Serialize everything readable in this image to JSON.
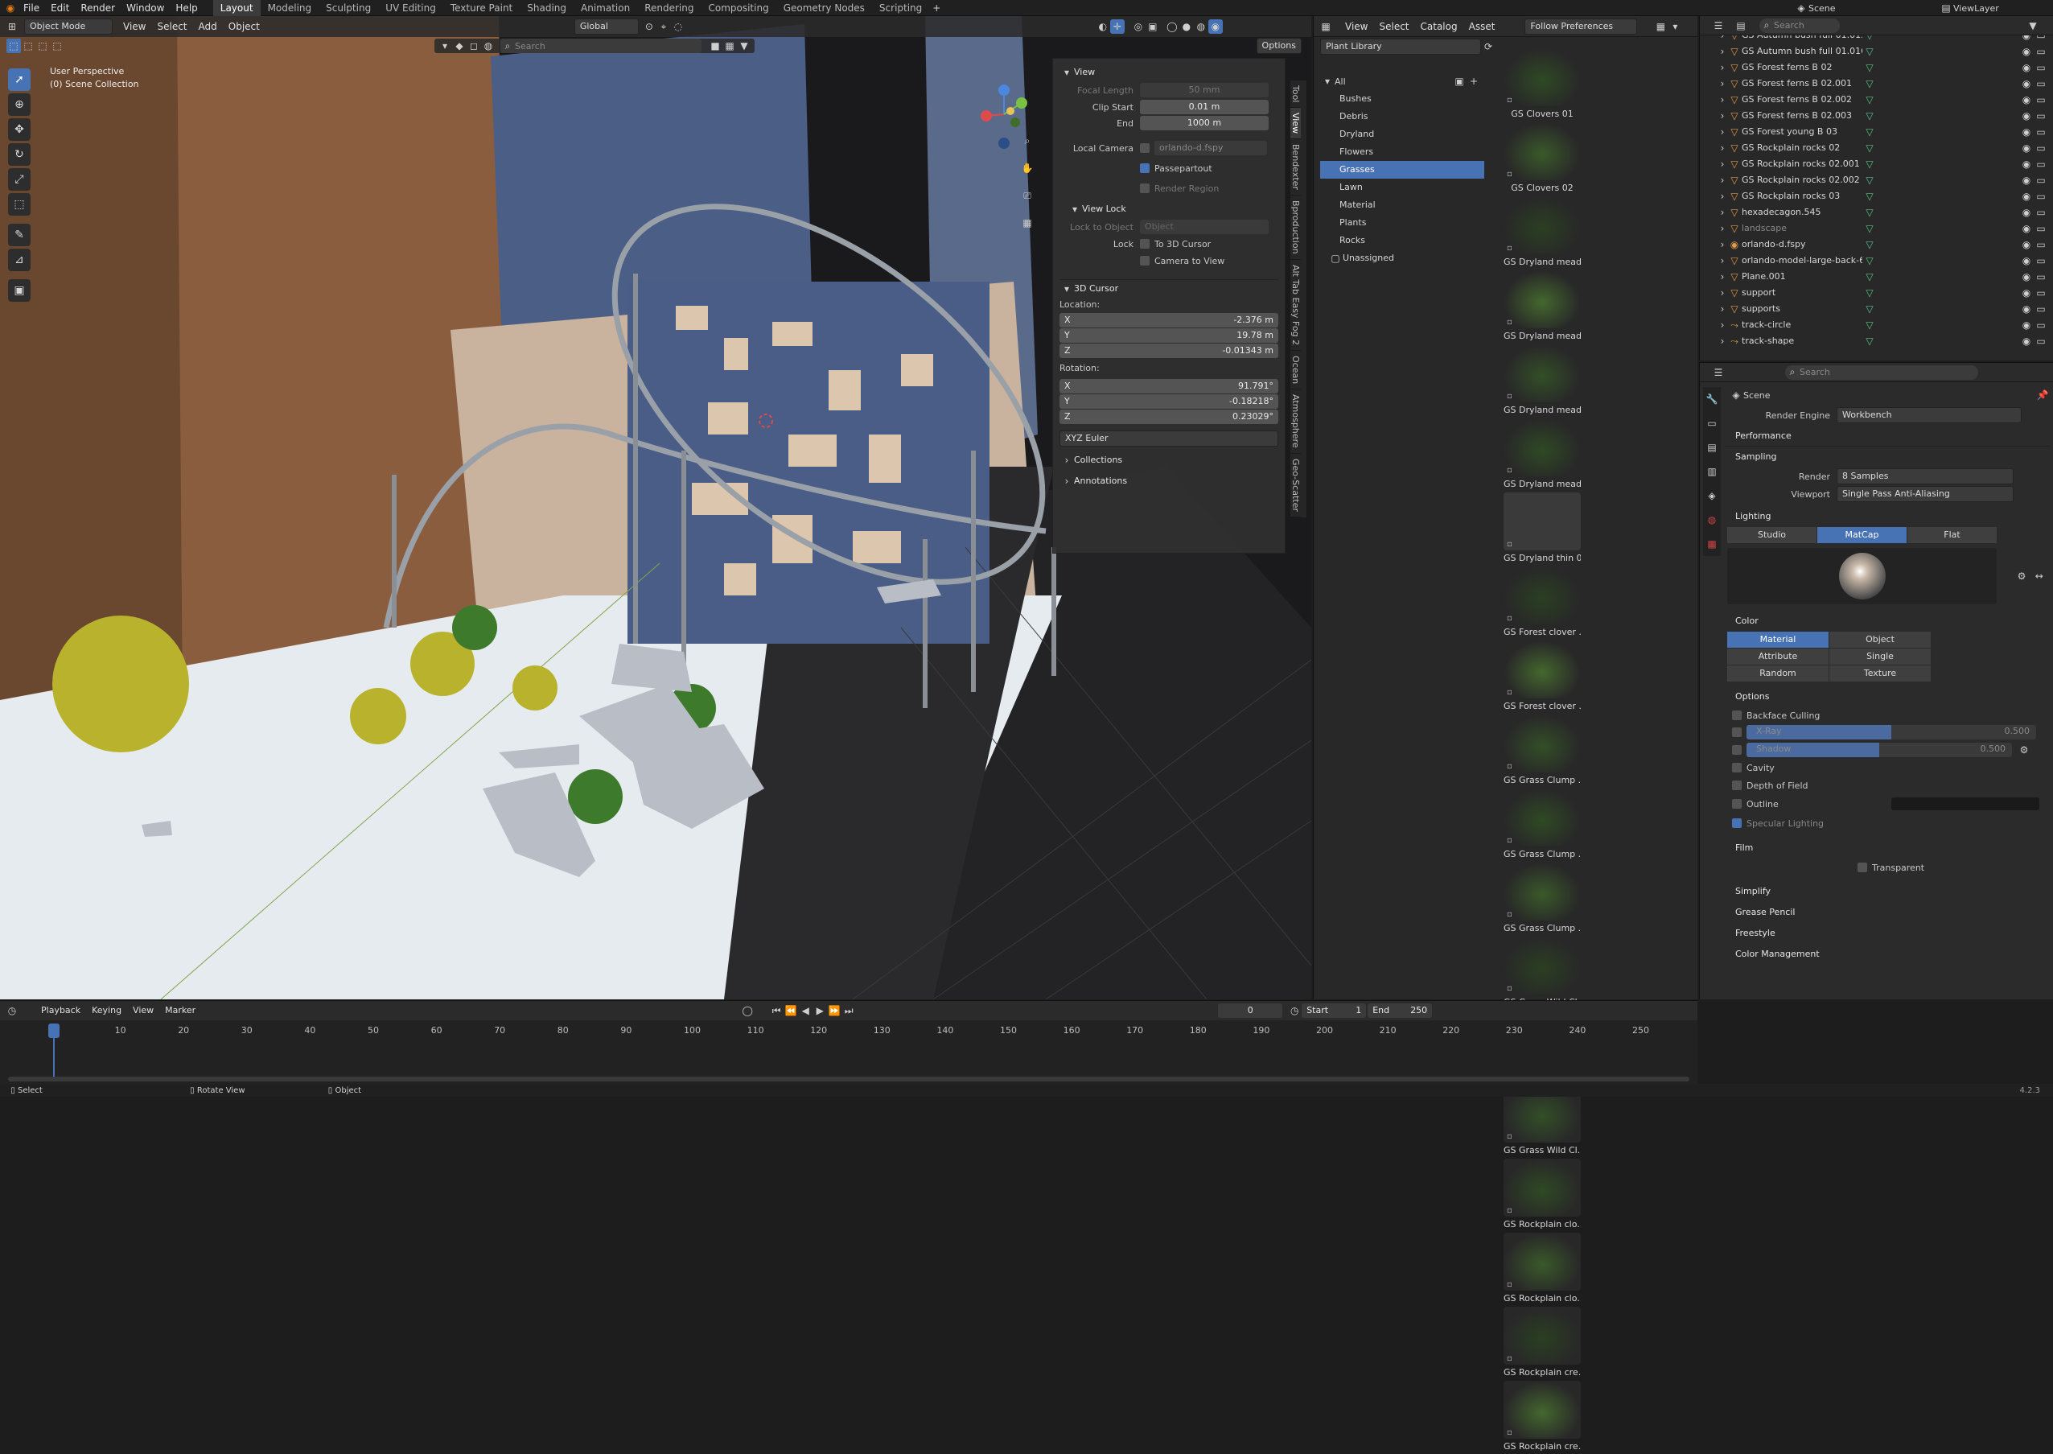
{
  "menu": [
    "File",
    "Edit",
    "Render",
    "Window",
    "Help"
  ],
  "workspaces": [
    "Layout",
    "Modeling",
    "Sculpting",
    "UV Editing",
    "Texture Paint",
    "Shading",
    "Animation",
    "Rendering",
    "Compositing",
    "Geometry Nodes",
    "Scripting"
  ],
  "active_workspace": "Layout",
  "scene_name": "Scene",
  "view_layer": "ViewLayer",
  "viewport": {
    "mode": "Object Mode",
    "menus": [
      "View",
      "Select",
      "Add",
      "Object"
    ],
    "transform_orientation": "Global",
    "options_label": "Options",
    "overlay_title": "User Perspective",
    "overlay_collection": "(0) Scene Collection",
    "search_placeholder": "Search"
  },
  "npanel": {
    "view_title": "View",
    "focal_length_label": "Focal Length",
    "focal_length": "50 mm",
    "clip_start_label": "Clip Start",
    "clip_start": "0.01 m",
    "end_label": "End",
    "clip_end": "1000 m",
    "local_camera_label": "Local Camera",
    "local_camera": "orlando-d.fspy",
    "passepartout": "Passepartout",
    "render_region": "Render Region",
    "view_lock_title": "View Lock",
    "lock_to_object_label": "Lock to Object",
    "lock_object_placeholder": "Object",
    "lock_label": "Lock",
    "to_3d_cursor": "To 3D Cursor",
    "camera_to_view": "Camera to View",
    "cursor_title": "3D Cursor",
    "location_label": "Location:",
    "loc": {
      "x": "-2.376 m",
      "y": "19.78 m",
      "z": "-0.01343 m"
    },
    "rotation_label": "Rotation:",
    "rot": {
      "x": "91.791°",
      "y": "-0.18218°",
      "z": "0.23029°"
    },
    "rotation_mode": "XYZ Euler",
    "collections": "Collections",
    "annotations": "Annotations",
    "axis_x": "X",
    "axis_y": "Y",
    "axis_z": "Z",
    "tabs": [
      "Tool",
      "View",
      "Bendexter",
      "Bproduction",
      "Alt Tab Easy Fog 2",
      "Ocean",
      "Atmosphere",
      "Geo-Scatter"
    ]
  },
  "asset_browser": {
    "menus": [
      "View",
      "Select",
      "Catalog",
      "Asset"
    ],
    "library": "Plant Library",
    "import": "Follow Preferences",
    "search_placeholder": "Search",
    "all_label": "All",
    "categories": [
      "Bushes",
      "Debris",
      "Dryland",
      "Flowers",
      "Grasses",
      "Lawn",
      "Material",
      "Plants",
      "Rocks"
    ],
    "selected_category": "Grasses",
    "unassigned": "Unassigned",
    "assets": [
      "GS Clovers 01",
      "GS Clovers 02",
      "GS Dryland mead...",
      "GS Dryland mead...",
      "GS Dryland mead...",
      "GS Dryland mead...",
      "GS Dryland thin 02",
      "GS Forest clover ...",
      "GS Forest clover ...",
      "GS Grass Clump ...",
      "GS Grass Clump ...",
      "GS Grass Clump ...",
      "GS Grass Wild Cl...",
      "GS Grass Wild Cl...",
      "GS Grass Wild Cl...",
      "GS Rockplain clo...",
      "GS Rockplain clo...",
      "GS Rockplain cre...",
      "GS Rockplain cre..."
    ]
  },
  "outliner": {
    "search_placeholder": "Search",
    "items": [
      "GS Autumn bush full 01.015",
      "GS Autumn bush full 01.016",
      "GS Forest ferns B 02",
      "GS Forest ferns B 02.001",
      "GS Forest ferns B 02.002",
      "GS Forest ferns B 02.003",
      "GS Forest young B 03",
      "GS Rockplain rocks 02",
      "GS Rockplain rocks 02.001",
      "GS Rockplain rocks 02.002",
      "GS Rockplain rocks 03",
      "hexadecagon.545",
      "landscape",
      "orlando-d.fspy",
      "orlando-model-large-back-6",
      "Plane.001",
      "support",
      "supports",
      "track-circle",
      "track-shape"
    ]
  },
  "properties": {
    "search_placeholder": "Search",
    "scene": "Scene",
    "render_engine_label": "Render Engine",
    "render_engine": "Workbench",
    "performance": "Performance",
    "sampling": "Sampling",
    "render_label": "Render",
    "render_samples": "8 Samples",
    "viewport_label": "Viewport",
    "viewport_aa": "Single Pass Anti-Aliasing",
    "lighting": "Lighting",
    "lighting_modes": [
      "Studio",
      "MatCap",
      "Flat"
    ],
    "lighting_active": "MatCap",
    "color": "Color",
    "color_modes": [
      "Material",
      "Object",
      "Attribute",
      "Single",
      "Random",
      "Texture"
    ],
    "color_active": "Material",
    "options": "Options",
    "backface_culling": "Backface Culling",
    "xray": "X-Ray",
    "xray_value": "0.500",
    "xray_fraction": 0.5,
    "shadow": "Shadow",
    "shadow_value": "0.500",
    "shadow_fraction": 0.5,
    "cavity": "Cavity",
    "depth_of_field": "Depth of Field",
    "outline": "Outline",
    "specular_lighting": "Specular Lighting",
    "film": "Film",
    "transparent": "Transparent",
    "simplify": "Simplify",
    "grease_pencil": "Grease Pencil",
    "freestyle": "Freestyle",
    "color_management": "Color Management"
  },
  "timeline": {
    "menus": [
      "Playback",
      "Keying",
      "View",
      "Marker"
    ],
    "current_frame": "0",
    "start_label": "Start",
    "start": "1",
    "end_label": "End",
    "end": "250",
    "ruler": [
      "0",
      "10",
      "20",
      "30",
      "40",
      "50",
      "60",
      "70",
      "80",
      "90",
      "100",
      "110",
      "120",
      "130",
      "140",
      "150",
      "160",
      "170",
      "180",
      "190",
      "200",
      "210",
      "220",
      "230",
      "240",
      "250"
    ]
  },
  "statusbar": {
    "select": "Select",
    "rotate": "Rotate View",
    "object": "Object",
    "version": "4.2.3"
  },
  "colors": {
    "accent": "#4772b3",
    "header": "#2b2b2b",
    "panel": "#303030",
    "outliner_green": "#59c28c",
    "object_orange": "#e09a4a"
  }
}
